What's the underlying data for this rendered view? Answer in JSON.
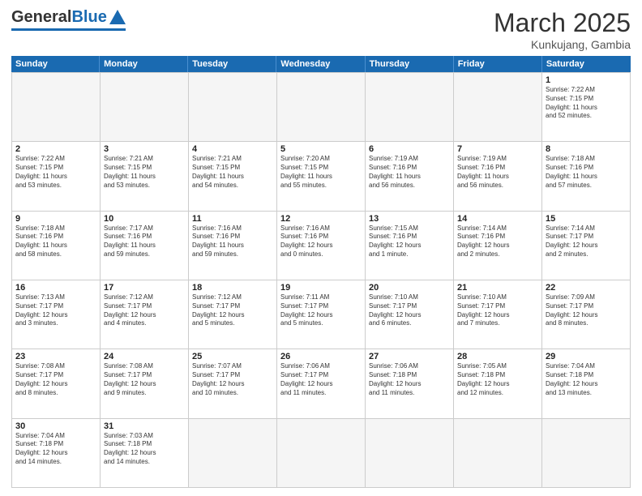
{
  "header": {
    "logo_general": "General",
    "logo_blue": "Blue",
    "month_title": "March 2025",
    "subtitle": "Kunkujang, Gambia"
  },
  "weekdays": [
    "Sunday",
    "Monday",
    "Tuesday",
    "Wednesday",
    "Thursday",
    "Friday",
    "Saturday"
  ],
  "weeks": [
    [
      {
        "day": "",
        "info": ""
      },
      {
        "day": "",
        "info": ""
      },
      {
        "day": "",
        "info": ""
      },
      {
        "day": "",
        "info": ""
      },
      {
        "day": "",
        "info": ""
      },
      {
        "day": "",
        "info": ""
      },
      {
        "day": "1",
        "info": "Sunrise: 7:22 AM\nSunset: 7:15 PM\nDaylight: 11 hours\nand 52 minutes."
      }
    ],
    [
      {
        "day": "2",
        "info": "Sunrise: 7:22 AM\nSunset: 7:15 PM\nDaylight: 11 hours\nand 53 minutes."
      },
      {
        "day": "3",
        "info": "Sunrise: 7:21 AM\nSunset: 7:15 PM\nDaylight: 11 hours\nand 53 minutes."
      },
      {
        "day": "4",
        "info": "Sunrise: 7:21 AM\nSunset: 7:15 PM\nDaylight: 11 hours\nand 54 minutes."
      },
      {
        "day": "5",
        "info": "Sunrise: 7:20 AM\nSunset: 7:15 PM\nDaylight: 11 hours\nand 55 minutes."
      },
      {
        "day": "6",
        "info": "Sunrise: 7:19 AM\nSunset: 7:16 PM\nDaylight: 11 hours\nand 56 minutes."
      },
      {
        "day": "7",
        "info": "Sunrise: 7:19 AM\nSunset: 7:16 PM\nDaylight: 11 hours\nand 56 minutes."
      },
      {
        "day": "8",
        "info": "Sunrise: 7:18 AM\nSunset: 7:16 PM\nDaylight: 11 hours\nand 57 minutes."
      }
    ],
    [
      {
        "day": "9",
        "info": "Sunrise: 7:18 AM\nSunset: 7:16 PM\nDaylight: 11 hours\nand 58 minutes."
      },
      {
        "day": "10",
        "info": "Sunrise: 7:17 AM\nSunset: 7:16 PM\nDaylight: 11 hours\nand 59 minutes."
      },
      {
        "day": "11",
        "info": "Sunrise: 7:16 AM\nSunset: 7:16 PM\nDaylight: 11 hours\nand 59 minutes."
      },
      {
        "day": "12",
        "info": "Sunrise: 7:16 AM\nSunset: 7:16 PM\nDaylight: 12 hours\nand 0 minutes."
      },
      {
        "day": "13",
        "info": "Sunrise: 7:15 AM\nSunset: 7:16 PM\nDaylight: 12 hours\nand 1 minute."
      },
      {
        "day": "14",
        "info": "Sunrise: 7:14 AM\nSunset: 7:16 PM\nDaylight: 12 hours\nand 2 minutes."
      },
      {
        "day": "15",
        "info": "Sunrise: 7:14 AM\nSunset: 7:17 PM\nDaylight: 12 hours\nand 2 minutes."
      }
    ],
    [
      {
        "day": "16",
        "info": "Sunrise: 7:13 AM\nSunset: 7:17 PM\nDaylight: 12 hours\nand 3 minutes."
      },
      {
        "day": "17",
        "info": "Sunrise: 7:12 AM\nSunset: 7:17 PM\nDaylight: 12 hours\nand 4 minutes."
      },
      {
        "day": "18",
        "info": "Sunrise: 7:12 AM\nSunset: 7:17 PM\nDaylight: 12 hours\nand 5 minutes."
      },
      {
        "day": "19",
        "info": "Sunrise: 7:11 AM\nSunset: 7:17 PM\nDaylight: 12 hours\nand 5 minutes."
      },
      {
        "day": "20",
        "info": "Sunrise: 7:10 AM\nSunset: 7:17 PM\nDaylight: 12 hours\nand 6 minutes."
      },
      {
        "day": "21",
        "info": "Sunrise: 7:10 AM\nSunset: 7:17 PM\nDaylight: 12 hours\nand 7 minutes."
      },
      {
        "day": "22",
        "info": "Sunrise: 7:09 AM\nSunset: 7:17 PM\nDaylight: 12 hours\nand 8 minutes."
      }
    ],
    [
      {
        "day": "23",
        "info": "Sunrise: 7:08 AM\nSunset: 7:17 PM\nDaylight: 12 hours\nand 8 minutes."
      },
      {
        "day": "24",
        "info": "Sunrise: 7:08 AM\nSunset: 7:17 PM\nDaylight: 12 hours\nand 9 minutes."
      },
      {
        "day": "25",
        "info": "Sunrise: 7:07 AM\nSunset: 7:17 PM\nDaylight: 12 hours\nand 10 minutes."
      },
      {
        "day": "26",
        "info": "Sunrise: 7:06 AM\nSunset: 7:17 PM\nDaylight: 12 hours\nand 11 minutes."
      },
      {
        "day": "27",
        "info": "Sunrise: 7:06 AM\nSunset: 7:18 PM\nDaylight: 12 hours\nand 11 minutes."
      },
      {
        "day": "28",
        "info": "Sunrise: 7:05 AM\nSunset: 7:18 PM\nDaylight: 12 hours\nand 12 minutes."
      },
      {
        "day": "29",
        "info": "Sunrise: 7:04 AM\nSunset: 7:18 PM\nDaylight: 12 hours\nand 13 minutes."
      }
    ],
    [
      {
        "day": "30",
        "info": "Sunrise: 7:04 AM\nSunset: 7:18 PM\nDaylight: 12 hours\nand 14 minutes."
      },
      {
        "day": "31",
        "info": "Sunrise: 7:03 AM\nSunset: 7:18 PM\nDaylight: 12 hours\nand 14 minutes."
      },
      {
        "day": "",
        "info": ""
      },
      {
        "day": "",
        "info": ""
      },
      {
        "day": "",
        "info": ""
      },
      {
        "day": "",
        "info": ""
      },
      {
        "day": "",
        "info": ""
      }
    ]
  ]
}
